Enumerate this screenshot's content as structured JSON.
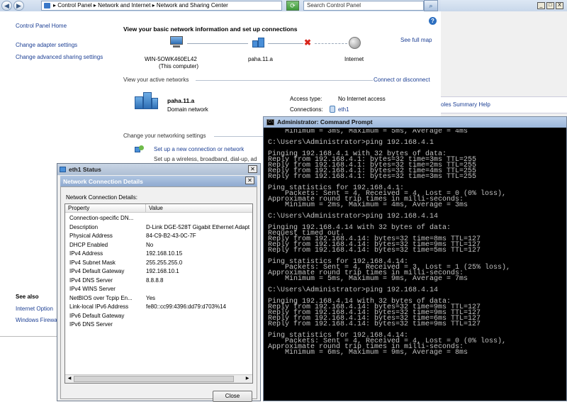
{
  "address_bar": {
    "breadcrumb": "▸ Control Panel ▸ Network and Internet ▸ Network and Sharing Center",
    "search_placeholder": "Search Control Panel",
    "back": "◀",
    "forward": "▶"
  },
  "left_nav": {
    "home": "Control Panel Home",
    "items": [
      "Change adapter settings",
      "Change advanced sharing settings"
    ],
    "see_also_title": "See also",
    "see_also": [
      "Internet Option",
      "Windows Firewa"
    ]
  },
  "main": {
    "heading": "View your basic network information and set up connections",
    "see_full_map": "See full map",
    "map": {
      "computer_name": "WIN-5OWK460EL42",
      "computer_sub": "(This computer)",
      "network": "paha.11.a",
      "internet": "Internet"
    },
    "active_networks_label": "View your active networks",
    "connect_disconnect": "Connect or disconnect",
    "active_network": {
      "name": "paha.11.a",
      "type": "Domain network",
      "access_type_label": "Access type:",
      "access_type": "No Internet access",
      "connections_label": "Connections:",
      "connection": "eth1"
    },
    "change_settings_label": "Change your networking settings",
    "setup_link": "Set up a new connection or network",
    "setup_desc": "Set up a wireless, broadband, dial-up, ad"
  },
  "bg_window": {
    "link": "oles Summary Help",
    "buttons": [
      "_",
      "□",
      "X"
    ]
  },
  "eth_status_dialog": {
    "title": "eth1 Status",
    "inner_title": "Network Connection Details",
    "group_label": "Network Connection Details:",
    "columns": [
      "Property",
      "Value"
    ],
    "rows": [
      {
        "property": "Connection-specific DN...",
        "value": ""
      },
      {
        "property": "Description",
        "value": "D-Link DGE-528T Gigabit Ethernet Adapt"
      },
      {
        "property": "Physical Address",
        "value": "84-C9-B2-43-0C-7F"
      },
      {
        "property": "DHCP Enabled",
        "value": "No"
      },
      {
        "property": "IPv4 Address",
        "value": "192.168.10.15"
      },
      {
        "property": "IPv4 Subnet Mask",
        "value": "255.255.255.0"
      },
      {
        "property": "IPv4 Default Gateway",
        "value": "192.168.10.1"
      },
      {
        "property": "IPv4 DNS Server",
        "value": "8.8.8.8"
      },
      {
        "property": "IPv4 WINS Server",
        "value": ""
      },
      {
        "property": "NetBIOS over Tcpip En...",
        "value": "Yes"
      },
      {
        "property": "Link-local IPv6 Address",
        "value": "fe80::cc99:4396:dd79:d703%14"
      },
      {
        "property": "IPv6 Default Gateway",
        "value": ""
      },
      {
        "property": "IPv6 DNS Server",
        "value": ""
      }
    ],
    "close_label": "Close"
  },
  "cmd_window": {
    "title": "Administrator: Command Prompt",
    "lines": [
      "    Minimum = 3ms, Maximum = 5ms, Average = 4ms",
      "",
      "C:\\Users\\Administrator>ping 192.168.4.1",
      "",
      "Pinging 192.168.4.1 with 32 bytes of data:",
      "Reply from 192.168.4.1: bytes=32 time=3ms TTL=255",
      "Reply from 192.168.4.1: bytes=32 time=2ms TTL=255",
      "Reply from 192.168.4.1: bytes=32 time=4ms TTL=255",
      "Reply from 192.168.4.1: bytes=32 time=3ms TTL=255",
      "",
      "Ping statistics for 192.168.4.1:",
      "    Packets: Sent = 4, Received = 4, Lost = 0 (0% loss),",
      "Approximate round trip times in milli-seconds:",
      "    Minimum = 2ms, Maximum = 4ms, Average = 3ms",
      "",
      "C:\\Users\\Administrator>ping 192.168.4.14",
      "",
      "Pinging 192.168.4.14 with 32 bytes of data:",
      "Request timed out.",
      "Reply from 192.168.4.14: bytes=32 time=8ms TTL=127",
      "Reply from 192.168.4.14: bytes=32 time=9ms TTL=127",
      "Reply from 192.168.4.14: bytes=32 time=5ms TTL=127",
      "",
      "Ping statistics for 192.168.4.14:",
      "    Packets: Sent = 4, Received = 3, Lost = 1 (25% loss),",
      "Approximate round trip times in milli-seconds:",
      "    Minimum = 5ms, Maximum = 9ms, Average = 7ms",
      "",
      "C:\\Users\\Administrator>ping 192.168.4.14",
      "",
      "Pinging 192.168.4.14 with 32 bytes of data:",
      "Reply from 192.168.4.14: bytes=32 time=9ms TTL=127",
      "Reply from 192.168.4.14: bytes=32 time=9ms TTL=127",
      "Reply from 192.168.4.14: bytes=32 time=6ms TTL=127",
      "Reply from 192.168.4.14: bytes=32 time=9ms TTL=127",
      "",
      "Ping statistics for 192.168.4.14:",
      "    Packets: Sent = 4, Received = 4, Lost = 0 (0% loss),",
      "Approximate round trip times in milli-seconds:",
      "    Minimum = 6ms, Maximum = 9ms, Average = 8ms"
    ]
  }
}
